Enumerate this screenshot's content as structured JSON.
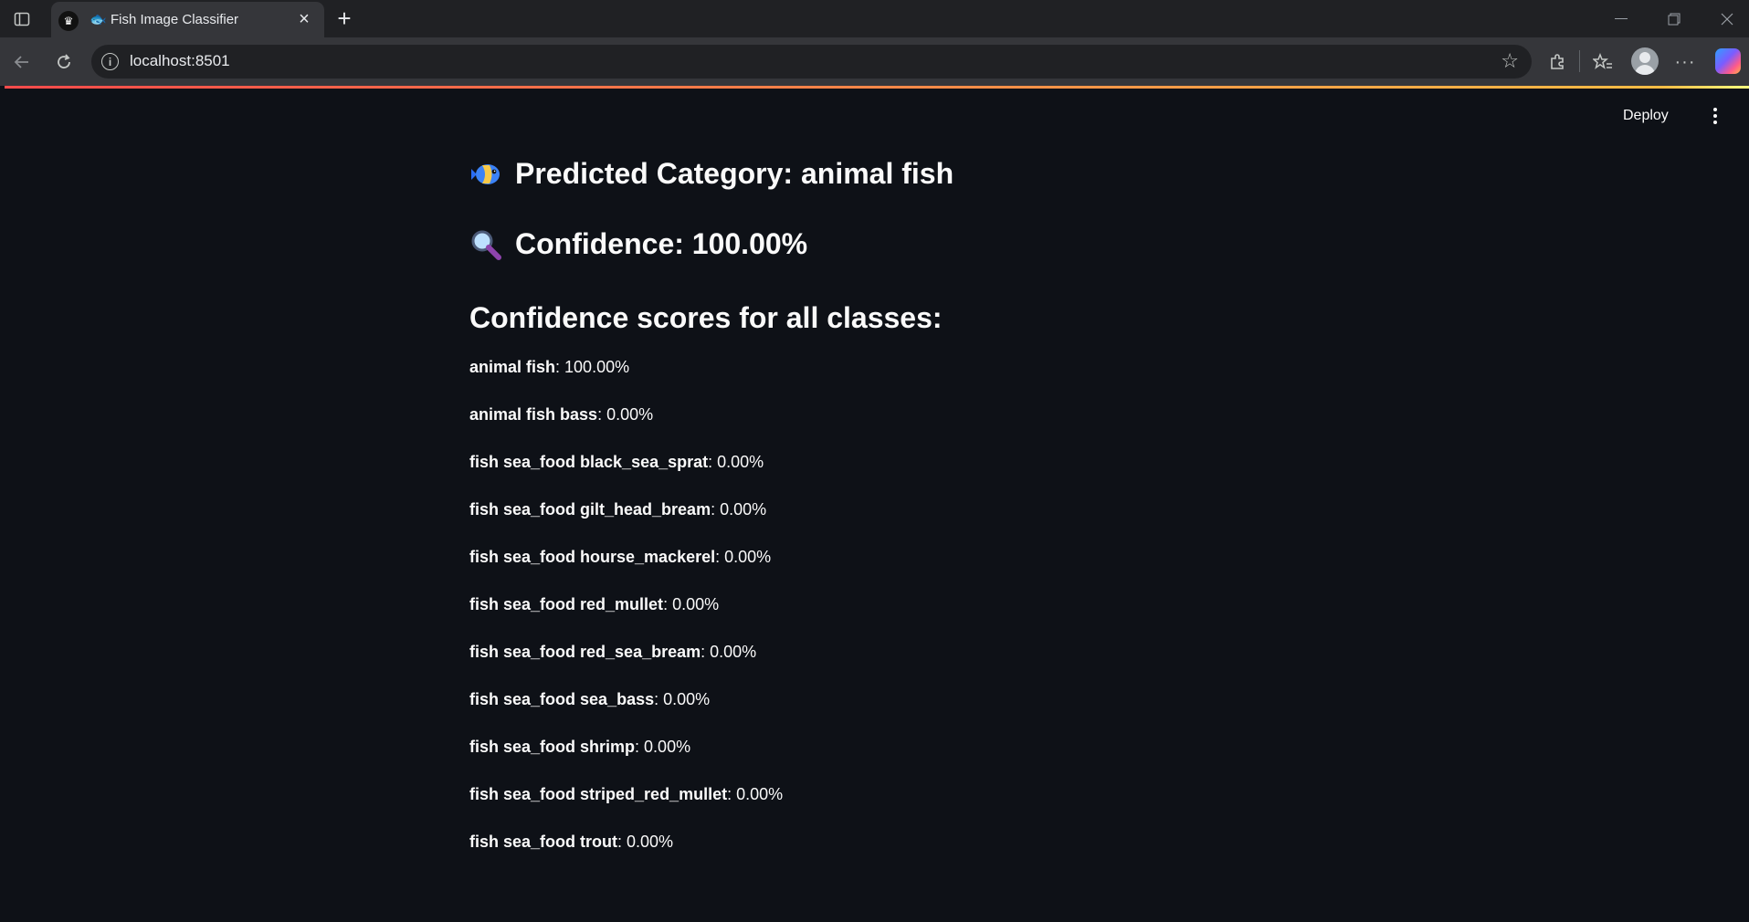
{
  "browser": {
    "tab_title": "Fish Image Classifier",
    "url": "localhost:8501"
  },
  "app": {
    "deploy_label": "Deploy",
    "predicted_heading": "Predicted Category: animal fish",
    "confidence_heading": "Confidence: 100.00%",
    "scores_heading": "Confidence scores for all classes:",
    "scores": [
      {
        "label": "animal fish",
        "value": ": 100.00%"
      },
      {
        "label": "animal fish bass",
        "value": ": 0.00%"
      },
      {
        "label": "fish sea_food black_sea_sprat",
        "value": ": 0.00%"
      },
      {
        "label": "fish sea_food gilt_head_bream",
        "value": ": 0.00%"
      },
      {
        "label": "fish sea_food hourse_mackerel",
        "value": ": 0.00%"
      },
      {
        "label": "fish sea_food red_mullet",
        "value": ": 0.00%"
      },
      {
        "label": "fish sea_food red_sea_bream",
        "value": ": 0.00%"
      },
      {
        "label": "fish sea_food sea_bass",
        "value": ": 0.00%"
      },
      {
        "label": "fish sea_food shrimp",
        "value": ": 0.00%"
      },
      {
        "label": "fish sea_food striped_red_mullet",
        "value": ": 0.00%"
      },
      {
        "label": "fish sea_food trout",
        "value": ": 0.00%"
      }
    ],
    "icons": {
      "predicted": "tropical-fish-icon",
      "confidence": "magnifier-icon"
    },
    "colors": {
      "background": "#0e1117",
      "text": "#fafafa",
      "accent_start": "#ff4b4b",
      "accent_end": "#fffd80"
    }
  }
}
